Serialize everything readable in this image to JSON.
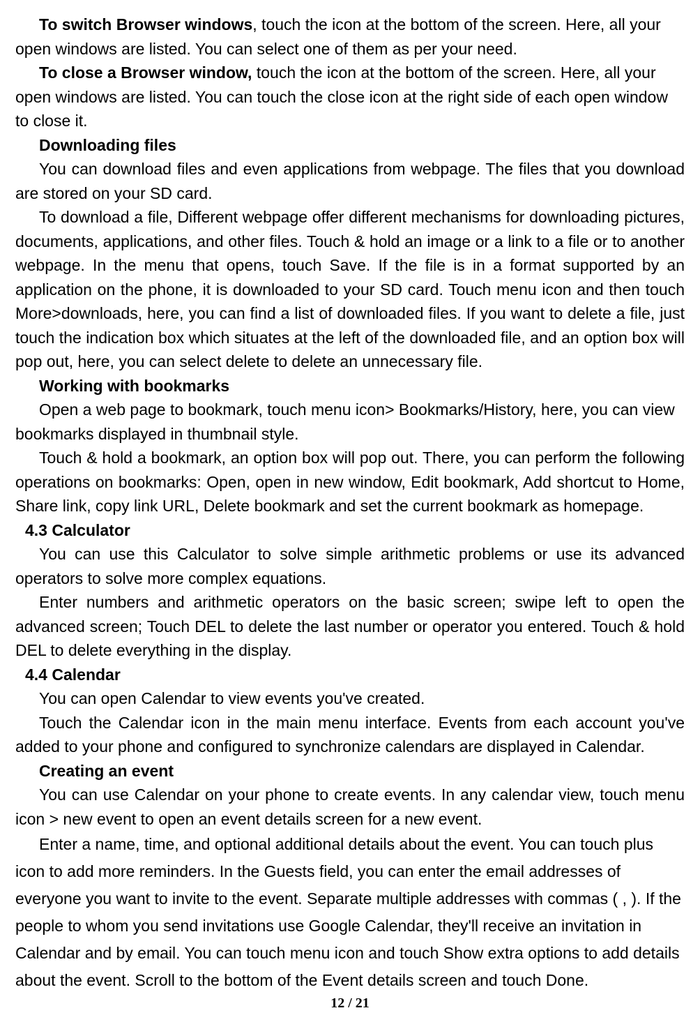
{
  "p1_bold": "To switch Browser windows",
  "p1_rest": ", touch the icon at the bottom of the screen. Here, all your open windows are listed. You can select one of them as per your need.",
  "p2_bold": "To close a Browser window,",
  "p2_rest": " touch the icon at the bottom of the screen. Here, all your open windows are listed. You can touch the close icon at the right side of each open window to close it.",
  "h3": "Downloading files",
  "p4": "You can download files and even applications from webpage. The files that you download are stored on your SD card.",
  "p5": "To download a file, Different webpage offer different mechanisms for downloading pictures, documents, applications, and other files. Touch & hold an image or a link to a file or to another webpage. In the menu that opens, touch Save. If the file is in a format supported by an application on the phone, it is downloaded to your SD card. Touch menu icon and then touch More>downloads, here, you can find a list of downloaded files. If you want to delete a file, just touch the indication box which situates at the left of the downloaded file, and an option box will pop out, here, you can select delete to delete an unnecessary file.",
  "h6": "Working with bookmarks",
  "p7": "Open a web page to bookmark, touch menu icon> Bookmarks/History, here, you can view bookmarks displayed in thumbnail style.",
  "p8": "Touch & hold a bookmark, an option box will pop out. There, you can perform the following operations on bookmarks: Open, open in new window, Edit bookmark, Add shortcut to Home, Share link, copy link URL, Delete bookmark and set the current bookmark as homepage.",
  "sh9": "4.3    Calculator",
  "p10": "You can use this Calculator to solve simple arithmetic problems or use its advanced operators to solve more complex equations.",
  "p11": "Enter numbers and arithmetic operators on the basic screen; swipe left to open the advanced screen; Touch DEL to delete the last number or operator you entered. Touch & hold DEL to delete everything in the display.",
  "sh12": "4.4    Calendar",
  "p13": "You can open Calendar to view events you've created.",
  "p14": "Touch the Calendar icon in the main menu interface. Events from each account you've added to your phone and configured to synchronize calendars are displayed in Calendar.",
  "h15": "Creating an event",
  "p16": "You can use Calendar on your phone to create events. In any calendar view, touch menu icon > new event to open an event details screen for a new event.",
  "p17": "Enter a name, time, and optional additional details about the event. You can touch plus icon to add more reminders. In the Guests field, you can enter the email addresses of everyone you want to invite to the event. Separate multiple addresses with commas ( , ). If the people to whom you send invitations use Google Calendar, they'll receive an invitation in Calendar and by email. You can touch menu icon and touch Show extra options to add details about the event. Scroll to the bottom of the Event details screen and touch Done.",
  "footer": "12 / 21"
}
